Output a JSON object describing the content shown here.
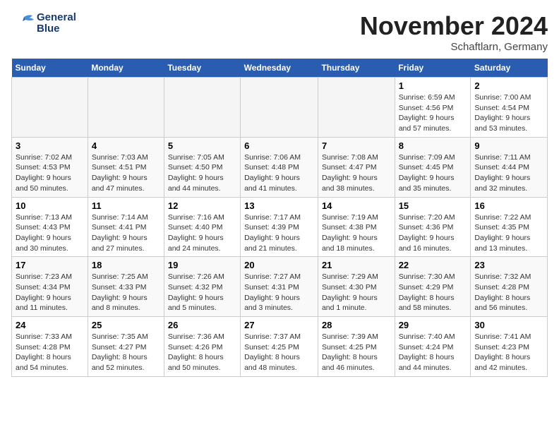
{
  "logo": {
    "line1": "General",
    "line2": "Blue"
  },
  "title": "November 2024",
  "location": "Schaftlarn, Germany",
  "weekdays": [
    "Sunday",
    "Monday",
    "Tuesday",
    "Wednesday",
    "Thursday",
    "Friday",
    "Saturday"
  ],
  "weeks": [
    [
      {
        "day": "",
        "sunrise": "",
        "sunset": "",
        "daylight": "",
        "empty": true
      },
      {
        "day": "",
        "sunrise": "",
        "sunset": "",
        "daylight": "",
        "empty": true
      },
      {
        "day": "",
        "sunrise": "",
        "sunset": "",
        "daylight": "",
        "empty": true
      },
      {
        "day": "",
        "sunrise": "",
        "sunset": "",
        "daylight": "",
        "empty": true
      },
      {
        "day": "",
        "sunrise": "",
        "sunset": "",
        "daylight": "",
        "empty": true
      },
      {
        "day": "1",
        "sunrise": "Sunrise: 6:59 AM",
        "sunset": "Sunset: 4:56 PM",
        "daylight": "Daylight: 9 hours and 57 minutes.",
        "empty": false
      },
      {
        "day": "2",
        "sunrise": "Sunrise: 7:00 AM",
        "sunset": "Sunset: 4:54 PM",
        "daylight": "Daylight: 9 hours and 53 minutes.",
        "empty": false
      }
    ],
    [
      {
        "day": "3",
        "sunrise": "Sunrise: 7:02 AM",
        "sunset": "Sunset: 4:53 PM",
        "daylight": "Daylight: 9 hours and 50 minutes.",
        "empty": false
      },
      {
        "day": "4",
        "sunrise": "Sunrise: 7:03 AM",
        "sunset": "Sunset: 4:51 PM",
        "daylight": "Daylight: 9 hours and 47 minutes.",
        "empty": false
      },
      {
        "day": "5",
        "sunrise": "Sunrise: 7:05 AM",
        "sunset": "Sunset: 4:50 PM",
        "daylight": "Daylight: 9 hours and 44 minutes.",
        "empty": false
      },
      {
        "day": "6",
        "sunrise": "Sunrise: 7:06 AM",
        "sunset": "Sunset: 4:48 PM",
        "daylight": "Daylight: 9 hours and 41 minutes.",
        "empty": false
      },
      {
        "day": "7",
        "sunrise": "Sunrise: 7:08 AM",
        "sunset": "Sunset: 4:47 PM",
        "daylight": "Daylight: 9 hours and 38 minutes.",
        "empty": false
      },
      {
        "day": "8",
        "sunrise": "Sunrise: 7:09 AM",
        "sunset": "Sunset: 4:45 PM",
        "daylight": "Daylight: 9 hours and 35 minutes.",
        "empty": false
      },
      {
        "day": "9",
        "sunrise": "Sunrise: 7:11 AM",
        "sunset": "Sunset: 4:44 PM",
        "daylight": "Daylight: 9 hours and 32 minutes.",
        "empty": false
      }
    ],
    [
      {
        "day": "10",
        "sunrise": "Sunrise: 7:13 AM",
        "sunset": "Sunset: 4:43 PM",
        "daylight": "Daylight: 9 hours and 30 minutes.",
        "empty": false
      },
      {
        "day": "11",
        "sunrise": "Sunrise: 7:14 AM",
        "sunset": "Sunset: 4:41 PM",
        "daylight": "Daylight: 9 hours and 27 minutes.",
        "empty": false
      },
      {
        "day": "12",
        "sunrise": "Sunrise: 7:16 AM",
        "sunset": "Sunset: 4:40 PM",
        "daylight": "Daylight: 9 hours and 24 minutes.",
        "empty": false
      },
      {
        "day": "13",
        "sunrise": "Sunrise: 7:17 AM",
        "sunset": "Sunset: 4:39 PM",
        "daylight": "Daylight: 9 hours and 21 minutes.",
        "empty": false
      },
      {
        "day": "14",
        "sunrise": "Sunrise: 7:19 AM",
        "sunset": "Sunset: 4:38 PM",
        "daylight": "Daylight: 9 hours and 18 minutes.",
        "empty": false
      },
      {
        "day": "15",
        "sunrise": "Sunrise: 7:20 AM",
        "sunset": "Sunset: 4:36 PM",
        "daylight": "Daylight: 9 hours and 16 minutes.",
        "empty": false
      },
      {
        "day": "16",
        "sunrise": "Sunrise: 7:22 AM",
        "sunset": "Sunset: 4:35 PM",
        "daylight": "Daylight: 9 hours and 13 minutes.",
        "empty": false
      }
    ],
    [
      {
        "day": "17",
        "sunrise": "Sunrise: 7:23 AM",
        "sunset": "Sunset: 4:34 PM",
        "daylight": "Daylight: 9 hours and 11 minutes.",
        "empty": false
      },
      {
        "day": "18",
        "sunrise": "Sunrise: 7:25 AM",
        "sunset": "Sunset: 4:33 PM",
        "daylight": "Daylight: 9 hours and 8 minutes.",
        "empty": false
      },
      {
        "day": "19",
        "sunrise": "Sunrise: 7:26 AM",
        "sunset": "Sunset: 4:32 PM",
        "daylight": "Daylight: 9 hours and 5 minutes.",
        "empty": false
      },
      {
        "day": "20",
        "sunrise": "Sunrise: 7:27 AM",
        "sunset": "Sunset: 4:31 PM",
        "daylight": "Daylight: 9 hours and 3 minutes.",
        "empty": false
      },
      {
        "day": "21",
        "sunrise": "Sunrise: 7:29 AM",
        "sunset": "Sunset: 4:30 PM",
        "daylight": "Daylight: 9 hours and 1 minute.",
        "empty": false
      },
      {
        "day": "22",
        "sunrise": "Sunrise: 7:30 AM",
        "sunset": "Sunset: 4:29 PM",
        "daylight": "Daylight: 8 hours and 58 minutes.",
        "empty": false
      },
      {
        "day": "23",
        "sunrise": "Sunrise: 7:32 AM",
        "sunset": "Sunset: 4:28 PM",
        "daylight": "Daylight: 8 hours and 56 minutes.",
        "empty": false
      }
    ],
    [
      {
        "day": "24",
        "sunrise": "Sunrise: 7:33 AM",
        "sunset": "Sunset: 4:28 PM",
        "daylight": "Daylight: 8 hours and 54 minutes.",
        "empty": false
      },
      {
        "day": "25",
        "sunrise": "Sunrise: 7:35 AM",
        "sunset": "Sunset: 4:27 PM",
        "daylight": "Daylight: 8 hours and 52 minutes.",
        "empty": false
      },
      {
        "day": "26",
        "sunrise": "Sunrise: 7:36 AM",
        "sunset": "Sunset: 4:26 PM",
        "daylight": "Daylight: 8 hours and 50 minutes.",
        "empty": false
      },
      {
        "day": "27",
        "sunrise": "Sunrise: 7:37 AM",
        "sunset": "Sunset: 4:25 PM",
        "daylight": "Daylight: 8 hours and 48 minutes.",
        "empty": false
      },
      {
        "day": "28",
        "sunrise": "Sunrise: 7:39 AM",
        "sunset": "Sunset: 4:25 PM",
        "daylight": "Daylight: 8 hours and 46 minutes.",
        "empty": false
      },
      {
        "day": "29",
        "sunrise": "Sunrise: 7:40 AM",
        "sunset": "Sunset: 4:24 PM",
        "daylight": "Daylight: 8 hours and 44 minutes.",
        "empty": false
      },
      {
        "day": "30",
        "sunrise": "Sunrise: 7:41 AM",
        "sunset": "Sunset: 4:23 PM",
        "daylight": "Daylight: 8 hours and 42 minutes.",
        "empty": false
      }
    ]
  ]
}
